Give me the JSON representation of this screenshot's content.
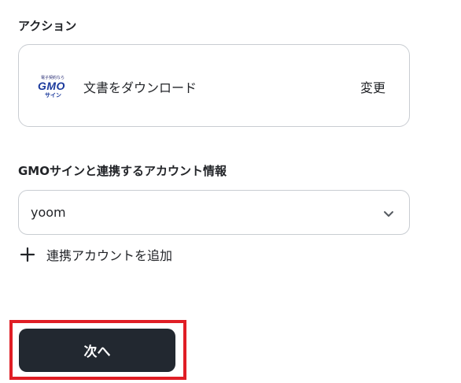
{
  "action_section": {
    "label": "アクション",
    "card": {
      "logo_tagline": "電子契約なら",
      "logo_brand": "GMO",
      "logo_sub": "サイン",
      "action_name": "文書をダウンロード",
      "change_label": "変更"
    }
  },
  "account_section": {
    "label": "GMOサインと連携するアカウント情報",
    "selected_account": "yoom",
    "add_account_label": "連携アカウントを追加"
  },
  "footer": {
    "next_label": "次へ"
  },
  "colors": {
    "button_bg": "#222830",
    "highlight": "#e01e25",
    "border": "#c9cdd2",
    "logo_blue": "#1b3a9c"
  }
}
